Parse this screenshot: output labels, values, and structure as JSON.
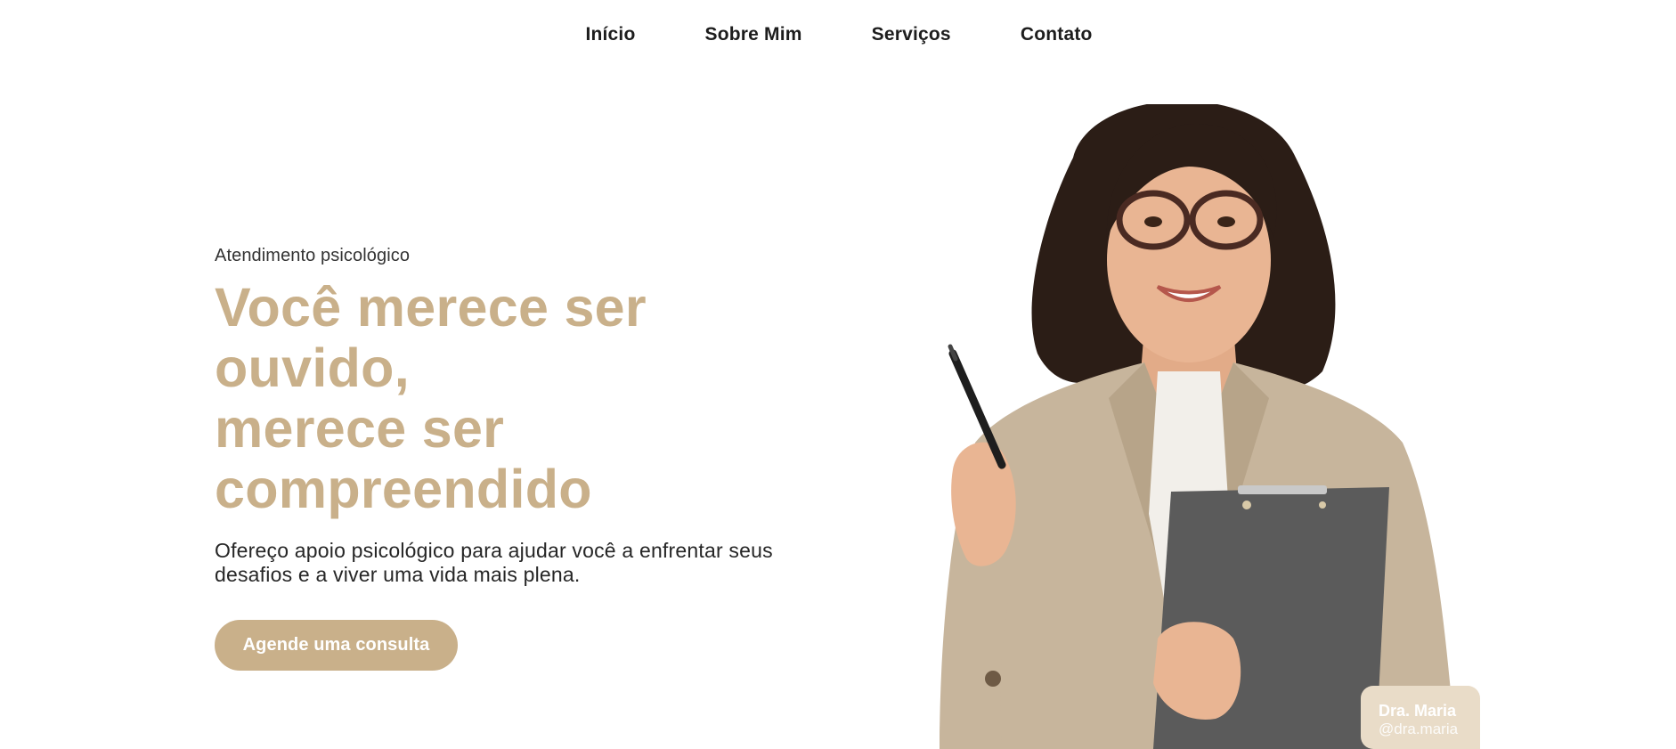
{
  "nav": {
    "items": [
      {
        "label": "Início"
      },
      {
        "label": "Sobre Mim"
      },
      {
        "label": "Serviços"
      },
      {
        "label": "Contato"
      }
    ]
  },
  "hero": {
    "eyebrow": "Atendimento psicológico",
    "headline": {
      "line1": "Você merece ser ouvido,",
      "line2": "merece ser",
      "line3": "compreendido"
    },
    "subtext": {
      "line1": "Ofereço apoio psicológico para ajudar você a enfrentar seus",
      "line2": "desafios e a viver uma vida mais plena."
    },
    "cta_label": "Agende uma consulta"
  },
  "badge": {
    "name": "Dra. Maria",
    "handle": "@dra.maria"
  },
  "colors": {
    "accent": "#c9b08a",
    "badge_bg": "#e9dcc8",
    "text_dark": "#1f1f1f"
  }
}
